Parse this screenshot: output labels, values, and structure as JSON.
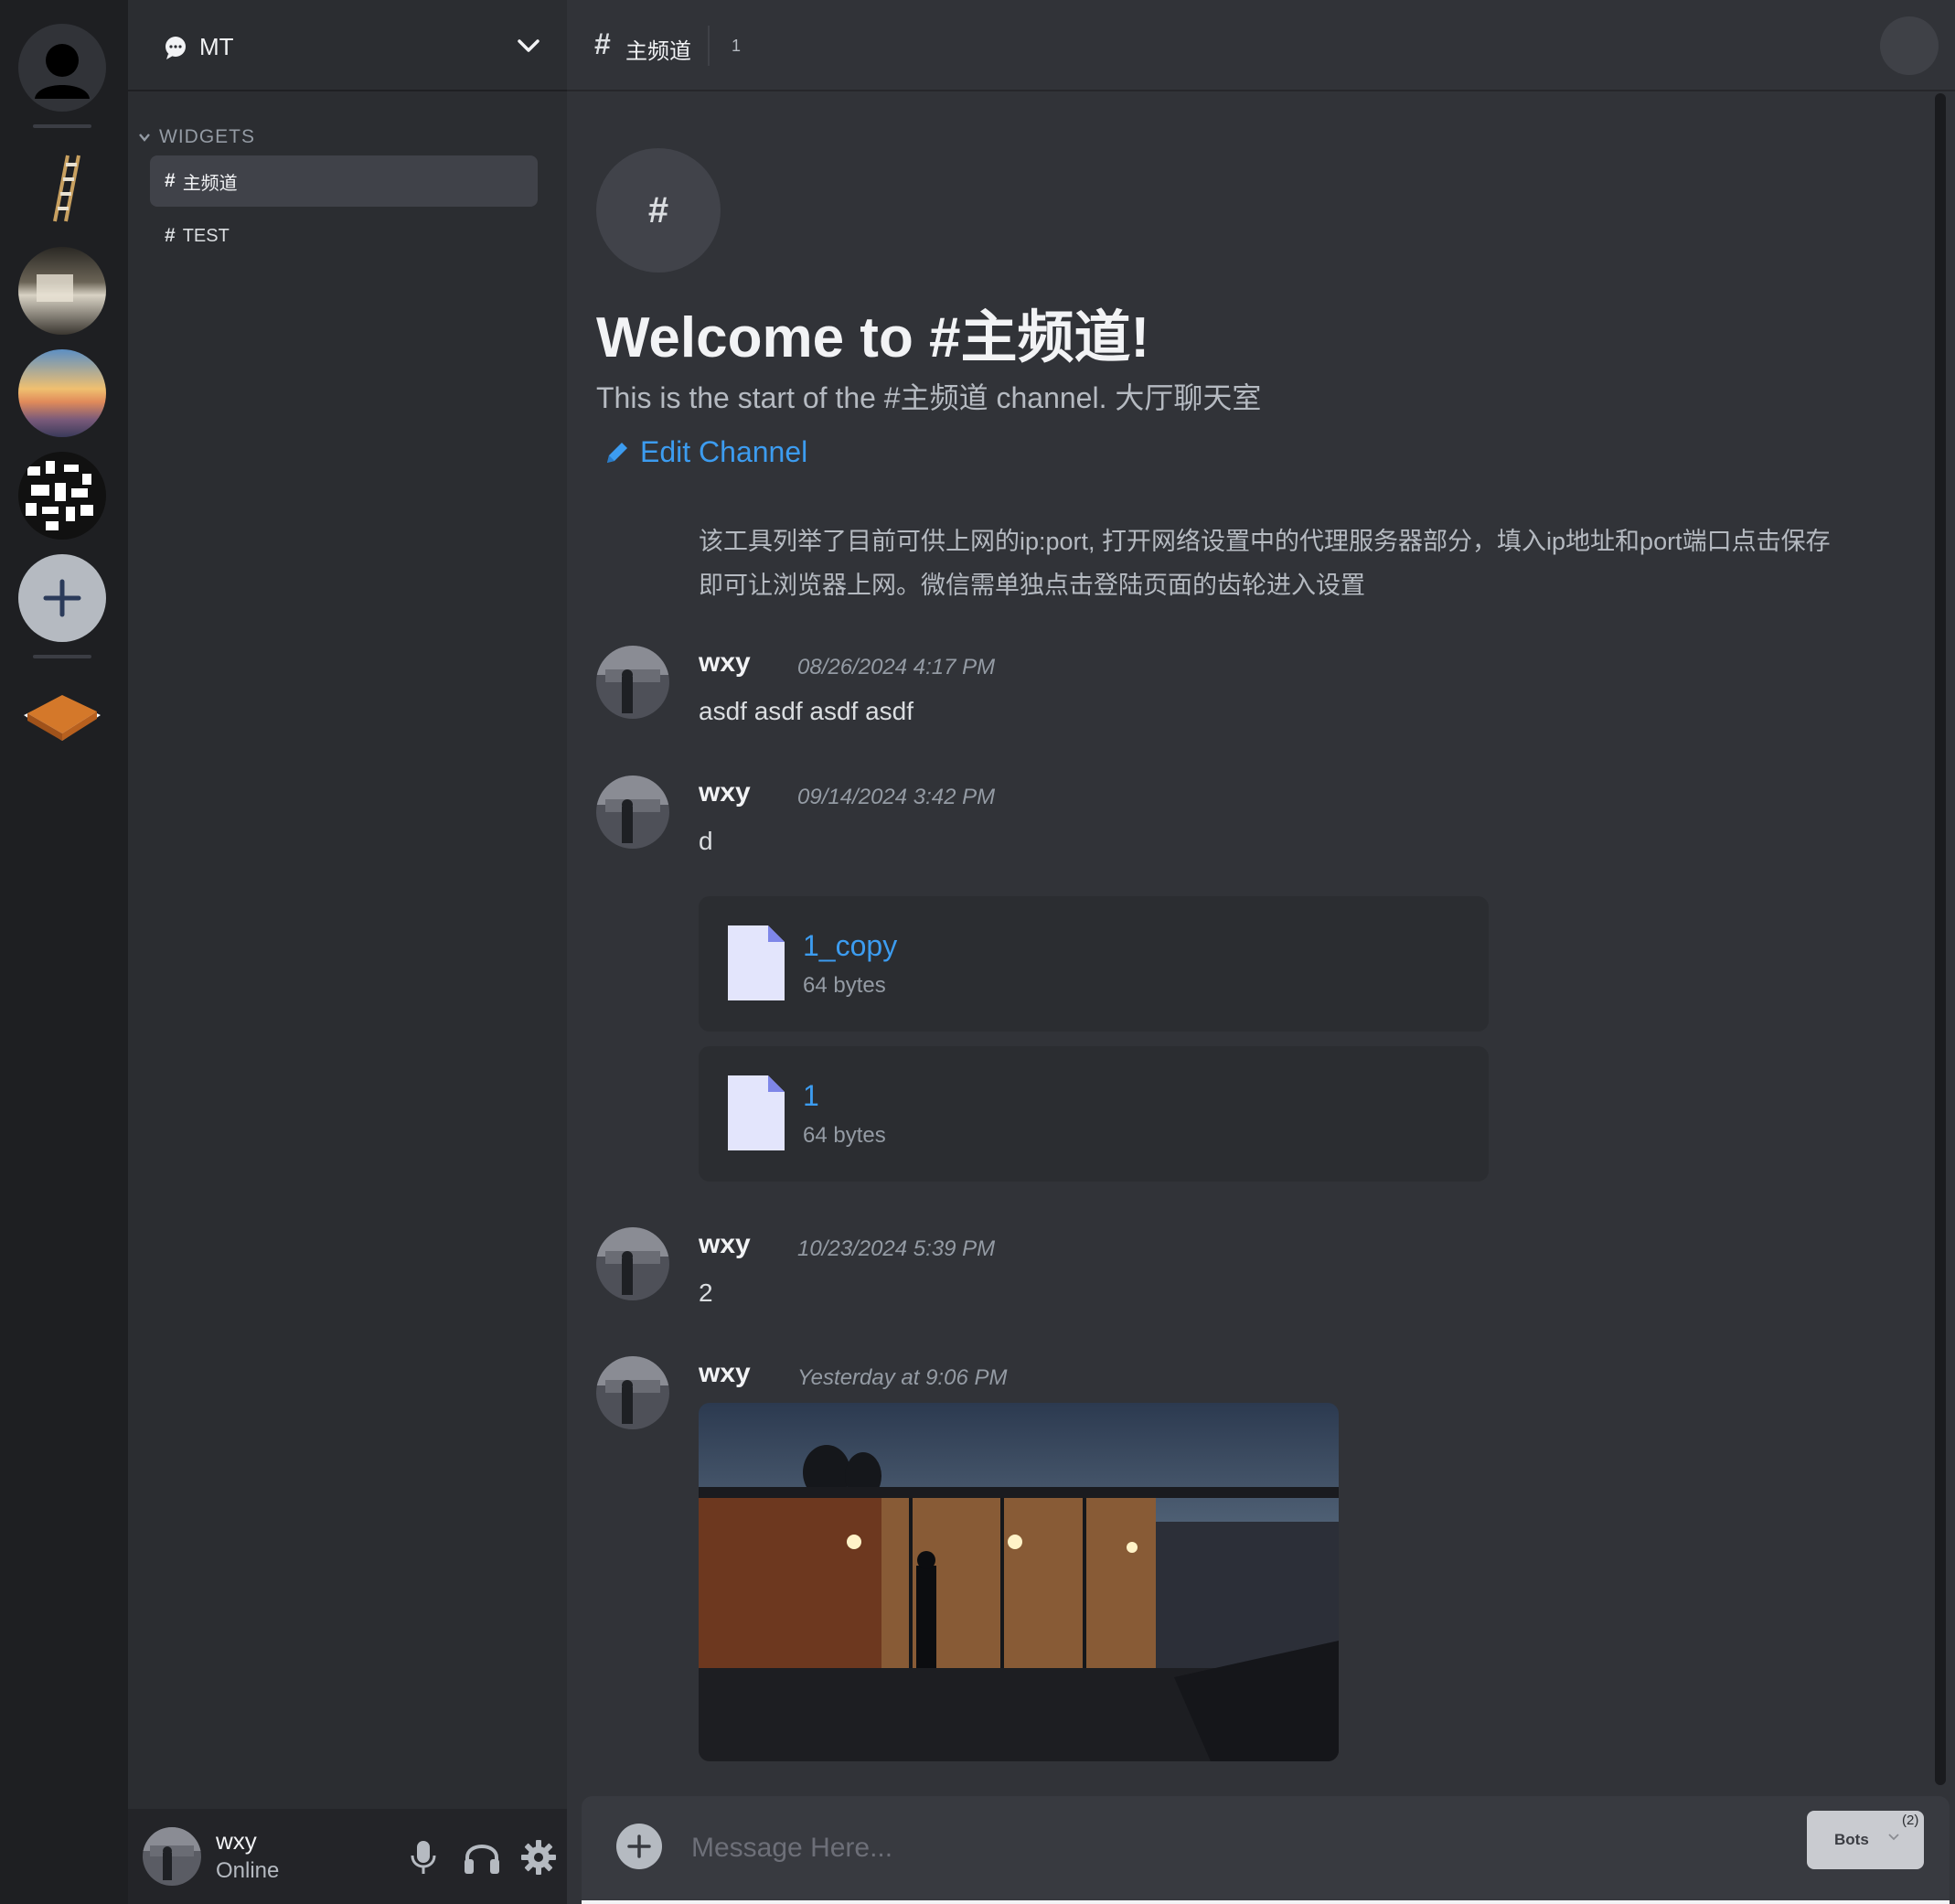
{
  "server": {
    "name": "MT"
  },
  "sidebar": {
    "category": "WIDGETS",
    "channels": [
      {
        "name": "主频道",
        "active": true
      },
      {
        "name": "TEST",
        "active": false
      }
    ]
  },
  "user": {
    "name": "wxy",
    "status": "Online"
  },
  "topbar": {
    "channel": "主频道",
    "count": "1"
  },
  "welcome": {
    "title": "Welcome to #主频道!",
    "desc": "This is the start of the #主频道 channel. 大厅聊天室",
    "edit": "Edit Channel"
  },
  "system_message": "该工具列举了目前可供上网的ip:port, 打开网络设置中的代理服务器部分，填入ip地址和port端口点击保存即可让浏览器上网。微信需单独点击登陆页面的齿轮进入设置",
  "messages": [
    {
      "author": "wxy",
      "time": "08/26/2024 4:17 PM",
      "text": "asdf asdf asdf asdf"
    },
    {
      "author": "wxy",
      "time": "09/14/2024 3:42 PM",
      "text": "d",
      "files": [
        {
          "name": "1_copy",
          "size": "64 bytes"
        },
        {
          "name": "1",
          "size": "64 bytes"
        }
      ]
    },
    {
      "author": "wxy",
      "time": "10/23/2024 5:39 PM",
      "text": "2"
    },
    {
      "author": "wxy",
      "time": "Yesterday at 9:06 PM",
      "text": ""
    }
  ],
  "composer": {
    "placeholder": "Message Here...",
    "bots_label": "Bots",
    "bots_count": "(2)"
  },
  "colors": {
    "accent_link": "#3c9cf0",
    "bg_main": "#313338",
    "bg_sidebar": "#2b2d31",
    "bg_rail": "#1e1f22"
  }
}
